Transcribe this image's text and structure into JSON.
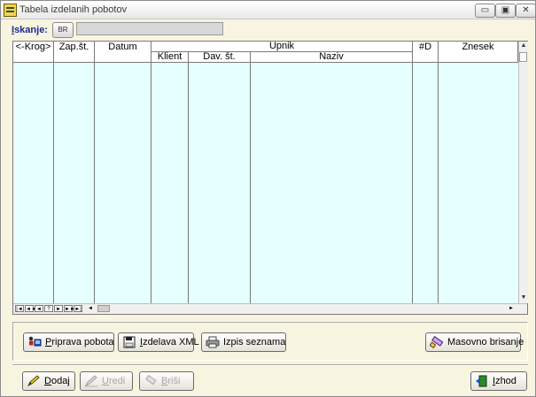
{
  "window": {
    "title": "Tabela izdelanih pobotov"
  },
  "titlebar_buttons": {
    "minimize": "▭",
    "restore": "▣",
    "close": "✕"
  },
  "search": {
    "label_accel": "I",
    "label_rest": "skanje:",
    "button_label": "BR",
    "value": ""
  },
  "grid": {
    "headers": {
      "krog": "<-Krog>",
      "zap_st": "Zap.št.",
      "datum": "Datum",
      "upnik": "Upnik",
      "klient": "Klient",
      "dav_st": "Dav. št.",
      "naziv": "Naziv",
      "num_d": "#D",
      "znesek": "Znesek"
    },
    "rows": []
  },
  "nav": {
    "first": "|◄",
    "prev_page": "◄◄",
    "prev": "◄",
    "help": "?",
    "next": "►",
    "next_page": "►►",
    "last": "►|",
    "scroll_left": "◄",
    "scroll_right": "►"
  },
  "actions": {
    "priprava_accel": "P",
    "priprava_rest": "riprava pobota",
    "izdelava_accel": "I",
    "izdelava_rest": "zdelava XML",
    "izpis_label": "Izpis seznama",
    "masovno_label": "Masovno brisanje"
  },
  "footer": {
    "dodaj_accel": "D",
    "dodaj_rest": "odaj",
    "uredi_accel": "U",
    "uredi_rest": "redi",
    "brisi_accel": "B",
    "brisi_rest": "riši",
    "izhod_accel": "I",
    "izhod_rest": "zhod"
  },
  "colors": {
    "grid_bg": "#e6ffff",
    "accent_label": "#1a2a8c"
  }
}
